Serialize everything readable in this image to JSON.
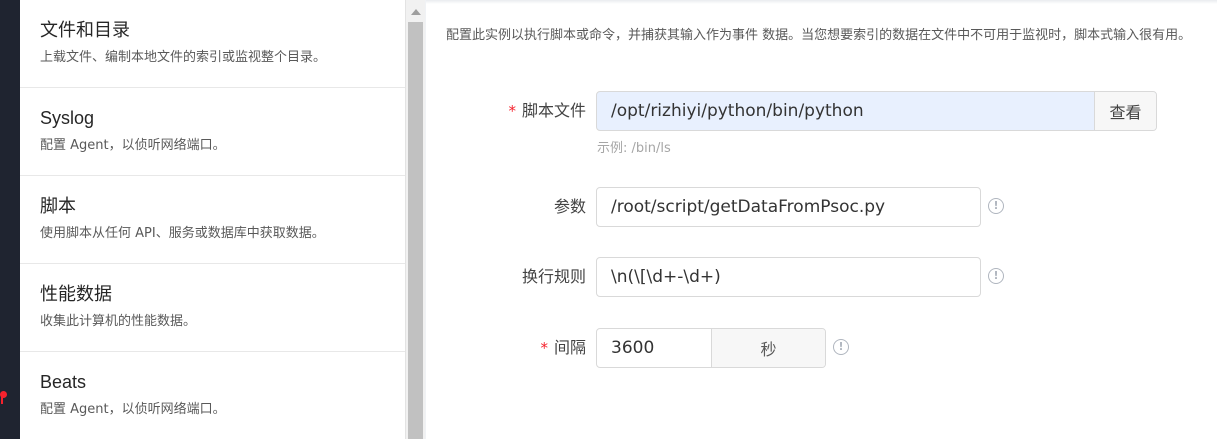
{
  "type_list": [
    {
      "title": "文件和目录",
      "desc": "上载文件、编制本地文件的索引或监视整个目录。"
    },
    {
      "title": "Syslog",
      "desc": "配置 Agent，以侦听网络端口。"
    },
    {
      "title": "脚本",
      "desc": "使用脚本从任何 API、服务或数据库中获取数据。"
    },
    {
      "title": "性能数据",
      "desc": "收集此计算机的性能数据。"
    },
    {
      "title": "Beats",
      "desc": "配置 Agent，以侦听网络端口。"
    }
  ],
  "form": {
    "intro": "配置此实例以执行脚本或命令，并捕获其输入作为事件 数据。当您想要索引的数据在文件中不可用于监视时，脚本式输入很有用。",
    "script_file": {
      "label": "脚本文件",
      "value": "/opt/rizhiyi/python/bin/python",
      "browse": "查看",
      "hint": "示例: /bin/ls",
      "required": "*"
    },
    "args": {
      "label": "参数",
      "value": "/root/script/getDataFromPsoc.py"
    },
    "split_rule": {
      "label": "换行规则",
      "value": "\\n(\\[\\d+-\\d+)"
    },
    "interval": {
      "label": "间隔",
      "value": "3600",
      "unit": "秒",
      "required": "*"
    },
    "info_glyph": "!"
  },
  "colors": {
    "required": "#f5222d",
    "autofill": "#e8f0fe"
  }
}
